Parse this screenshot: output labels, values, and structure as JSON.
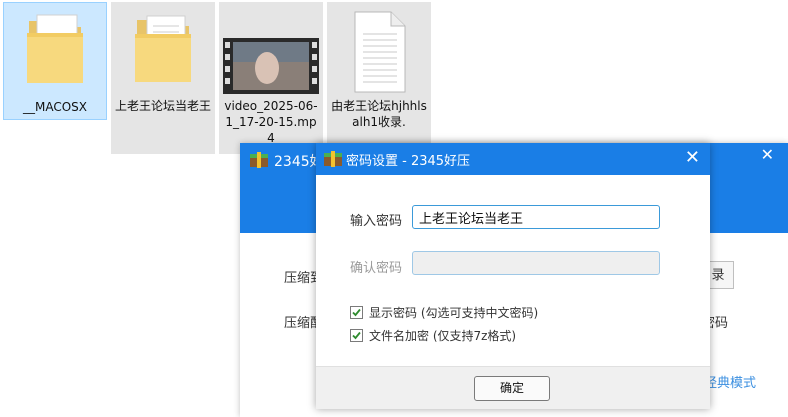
{
  "desktop": {
    "files": [
      {
        "name": "__MACOSX",
        "type": "folder",
        "state": "selected"
      },
      {
        "name": "上老王论坛当老王",
        "type": "folder",
        "state": "hover"
      },
      {
        "name": "video_2025-06-1_17-20-15.mp4",
        "type": "video",
        "state": "hover"
      },
      {
        "name": "由老王论坛hjhhlsalh1收录.",
        "type": "document",
        "state": "hover"
      }
    ]
  },
  "bg_window": {
    "title": "2345好",
    "label_1": "压缩到",
    "label_2": "压缩配",
    "button_text": "录",
    "right_text": "密码",
    "link_text": "经典模式"
  },
  "dialog": {
    "title": "密码设置 - 2345好压",
    "password_label": "输入密码",
    "password_value": "上老王论坛当老王",
    "confirm_label": "确认密码",
    "confirm_value": "",
    "show_password_label": "显示密码 (勾选可支持中文密码)",
    "show_password_checked": true,
    "encrypt_names_label": "文件名加密 (仅支持7z格式)",
    "encrypt_names_checked": true,
    "ok_label": "确定"
  },
  "colors": {
    "accent": "#1a7ee6",
    "selection": "#cce8ff",
    "link": "#3b8fe0",
    "check": "#2e8b2e"
  }
}
